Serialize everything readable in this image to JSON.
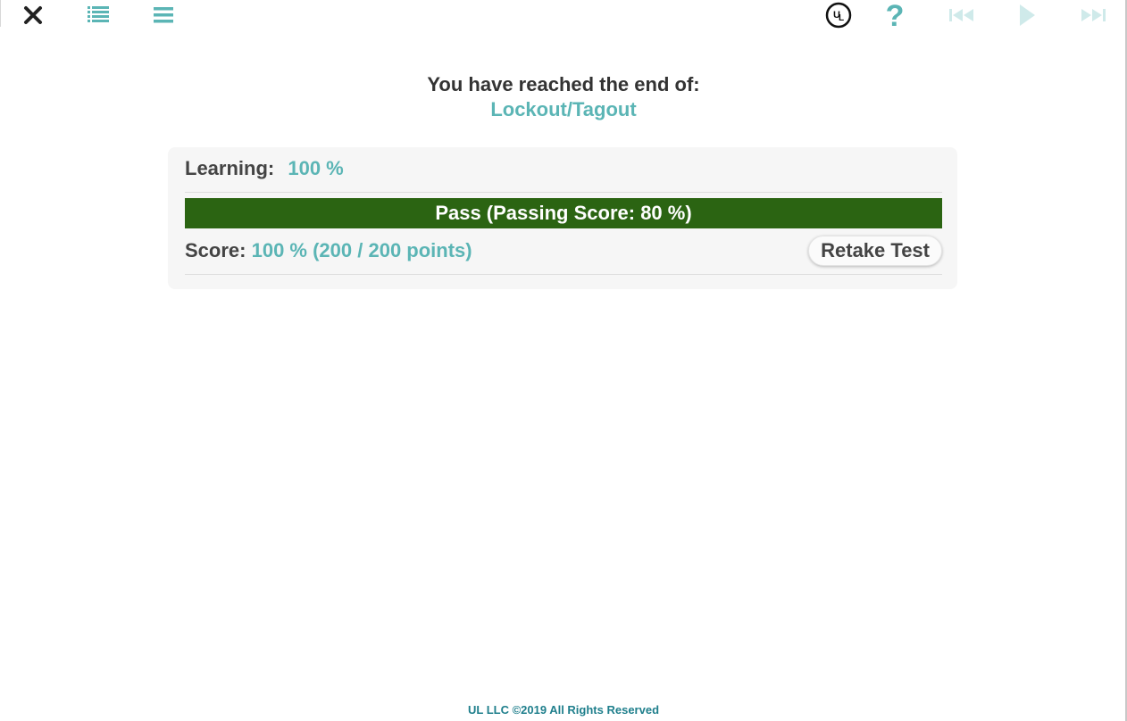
{
  "toolbar": {
    "left_icons": [
      "close-icon",
      "list-icon",
      "menu-icon"
    ],
    "right_icons": [
      "ul-logo-icon",
      "help-icon",
      "first-page-icon",
      "play-icon",
      "last-page-icon"
    ]
  },
  "colors": {
    "accent": "#5bb5b5",
    "pass": "#2b6412",
    "text": "#444444",
    "footer": "#1f7f8c"
  },
  "end_message": {
    "heading": "You have reached the end of:",
    "course_title": "Lockout/Tagout"
  },
  "results": {
    "learning_label": "Learning:",
    "learning_value": "100 %",
    "pass_text": "Pass (Passing Score: 80 %)",
    "score_label": "Score:",
    "score_value": "100 % (200 / 200 points)",
    "retake_label": "Retake Test"
  },
  "footer": {
    "copyright": "UL LLC ©2019 All Rights Reserved"
  }
}
